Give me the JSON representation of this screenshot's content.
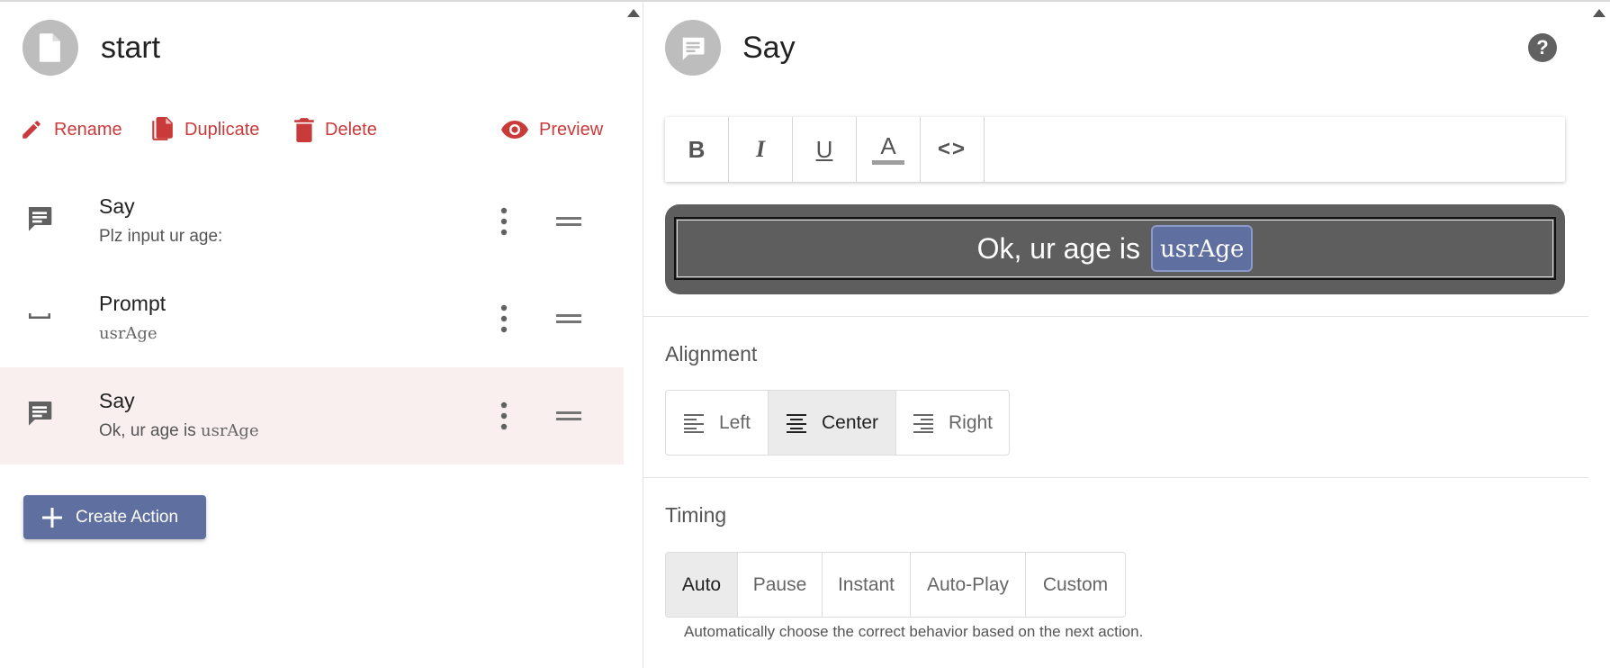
{
  "left": {
    "doc_title": "start",
    "toolbar": {
      "rename": "Rename",
      "duplicate": "Duplicate",
      "delete": "Delete",
      "preview": "Preview"
    },
    "actions": [
      {
        "icon": "chat-icon",
        "title": "Say",
        "subtitle_text": "Plz input ur age:",
        "subtitle_var": ""
      },
      {
        "icon": "space-icon",
        "title": "Prompt",
        "subtitle_text": "",
        "subtitle_var": "usrAge"
      },
      {
        "icon": "chat-icon",
        "title": "Say",
        "subtitle_text": "Ok, ur age is ",
        "subtitle_var": "usrAge",
        "selected": true
      }
    ],
    "create_action": "Create Action"
  },
  "right": {
    "title": "Say",
    "help": "?",
    "format_buttons": [
      "bold",
      "italic",
      "underline",
      "text-color",
      "code"
    ],
    "format_labels": {
      "bold": "B",
      "italic": "I",
      "underline": "U",
      "text_color": "A",
      "code": "<>"
    },
    "preview": {
      "text": "Ok, ur age is",
      "variable": "usrAge"
    },
    "alignment": {
      "label": "Alignment",
      "options": [
        "Left",
        "Center",
        "Right"
      ],
      "selected": "Center"
    },
    "timing": {
      "label": "Timing",
      "options": [
        "Auto",
        "Pause",
        "Instant",
        "Auto-Play",
        "Custom"
      ],
      "selected": "Auto",
      "hint": "Automatically choose the correct behavior based on the next action."
    }
  },
  "colors": {
    "accent_red": "#c93a3a",
    "primary_blue": "#5f6fa0",
    "selected_row": "#f8efee",
    "preview_bg": "#5e5e5e"
  }
}
